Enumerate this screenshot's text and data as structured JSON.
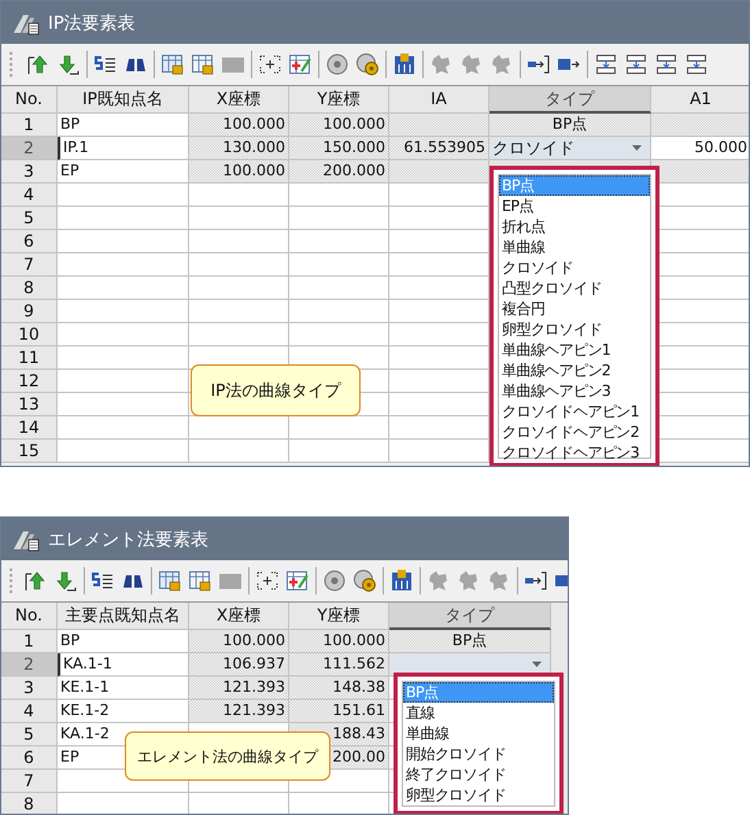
{
  "windows": [
    {
      "title": "IP法要素表",
      "columns": [
        {
          "label": "No.",
          "kind": "index",
          "selected": false
        },
        {
          "label": "IP既知点名",
          "kind": "name",
          "selected": false
        },
        {
          "label": "X座標",
          "kind": "number",
          "selected": false
        },
        {
          "label": "Y座標",
          "kind": "number",
          "selected": false
        },
        {
          "label": "IA",
          "kind": "number",
          "selected": false
        },
        {
          "label": "タイプ",
          "kind": "choice",
          "selected": true
        },
        {
          "label": "A1",
          "kind": "number",
          "selected": false
        }
      ],
      "rows": [
        {
          "no": "1",
          "selected": false,
          "cells": [
            {
              "kind": "text",
              "text": "BP",
              "shaded": false
            },
            {
              "kind": "text",
              "text": "100.000",
              "shaded": true
            },
            {
              "kind": "text",
              "text": "100.000",
              "shaded": true
            },
            {
              "kind": "text",
              "shaded": true
            },
            {
              "kind": "text",
              "text": "BP点",
              "shaded": true
            },
            {
              "kind": "text",
              "shaded": true
            }
          ]
        },
        {
          "no": "2",
          "selected": true,
          "cells": [
            {
              "kind": "text",
              "text": "IP.1",
              "shaded": false
            },
            {
              "kind": "text",
              "text": "130.000",
              "shaded": true
            },
            {
              "kind": "text",
              "text": "150.000",
              "shaded": true
            },
            {
              "kind": "text",
              "text": "61.553905",
              "shaded": true
            },
            {
              "kind": "combo",
              "text": "クロソイド"
            },
            {
              "kind": "text",
              "text": "50.000",
              "shaded": false
            }
          ]
        },
        {
          "no": "3",
          "selected": false,
          "cells": [
            {
              "kind": "text",
              "text": "EP",
              "shaded": false
            },
            {
              "kind": "text",
              "text": "100.000",
              "shaded": true
            },
            {
              "kind": "text",
              "text": "200.000",
              "shaded": true
            },
            {
              "kind": "text",
              "shaded": true
            },
            {
              "kind": "text",
              "shaded": true
            },
            {
              "kind": "text",
              "shaded": true
            }
          ]
        },
        {
          "no": "4",
          "selected": false
        },
        {
          "no": "5",
          "selected": false
        },
        {
          "no": "6",
          "selected": false
        },
        {
          "no": "7",
          "selected": false
        },
        {
          "no": "8",
          "selected": false
        },
        {
          "no": "9",
          "selected": false
        },
        {
          "no": "10",
          "selected": false
        },
        {
          "no": "11",
          "selected": false
        },
        {
          "no": "12",
          "selected": false
        },
        {
          "no": "13",
          "selected": false
        },
        {
          "no": "14",
          "selected": false
        },
        {
          "no": "15",
          "selected": false
        }
      ],
      "dropdown": [
        {
          "label": "BP点",
          "selected": true
        },
        {
          "label": "EP点",
          "selected": false
        },
        {
          "label": "折れ点",
          "selected": false
        },
        {
          "label": "単曲線",
          "selected": false
        },
        {
          "label": "クロソイド",
          "selected": false
        },
        {
          "label": "凸型クロソイド",
          "selected": false
        },
        {
          "label": "複合円",
          "selected": false
        },
        {
          "label": "卵型クロソイド",
          "selected": false
        },
        {
          "label": "単曲線ヘアピン1",
          "selected": false
        },
        {
          "label": "単曲線ヘアピン2",
          "selected": false
        },
        {
          "label": "単曲線ヘアピン3",
          "selected": false
        },
        {
          "label": "クロソイドヘアピン1",
          "selected": false
        },
        {
          "label": "クロソイドヘアピン2",
          "selected": false
        },
        {
          "label": "クロソイドヘアピン3",
          "selected": false
        }
      ],
      "callout": "IP法の曲線タイプ"
    },
    {
      "title": "エレメント法要素表",
      "columns": [
        {
          "label": "No.",
          "kind": "index",
          "selected": false
        },
        {
          "label": "主要点既知点名",
          "kind": "name",
          "selected": false
        },
        {
          "label": "X座標",
          "kind": "number",
          "selected": false
        },
        {
          "label": "Y座標",
          "kind": "number",
          "selected": false
        },
        {
          "label": "タイプ",
          "kind": "choice",
          "selected": true
        }
      ],
      "rows": [
        {
          "no": "1",
          "selected": false,
          "cells": [
            {
              "kind": "text",
              "text": "BP",
              "shaded": false
            },
            {
              "kind": "text",
              "text": "100.000",
              "shaded": true
            },
            {
              "kind": "text",
              "text": "100.000",
              "shaded": true
            },
            {
              "kind": "text",
              "text": "BP点",
              "shaded": true
            }
          ]
        },
        {
          "no": "2",
          "selected": true,
          "cells": [
            {
              "kind": "text",
              "text": "KA.1-1",
              "shaded": false
            },
            {
              "kind": "text",
              "text": "106.937",
              "shaded": true
            },
            {
              "kind": "text",
              "text": "111.562",
              "shaded": true
            },
            {
              "kind": "combo"
            }
          ]
        },
        {
          "no": "3",
          "selected": false,
          "cells": [
            {
              "kind": "text",
              "text": "KE.1-1",
              "shaded": false
            },
            {
              "kind": "text",
              "text": "121.393",
              "shaded": true
            },
            {
              "kind": "text",
              "text": "148.38",
              "shaded": true
            }
          ]
        },
        {
          "no": "4",
          "selected": false,
          "cells": [
            {
              "kind": "text",
              "text": "KE.1-2",
              "shaded": false
            },
            {
              "kind": "text",
              "text": "121.393",
              "shaded": true
            },
            {
              "kind": "text",
              "text": "151.61",
              "shaded": true
            }
          ]
        },
        {
          "no": "5",
          "selected": false,
          "cells": [
            {
              "kind": "text",
              "text": "KA.1-2",
              "shaded": false
            },
            {
              "kind": "text"
            },
            {
              "kind": "text",
              "text": "188.43",
              "shaded": true
            }
          ]
        },
        {
          "no": "6",
          "selected": false,
          "cells": [
            {
              "kind": "text",
              "text": "EP",
              "shaded": false
            },
            {
              "kind": "text"
            },
            {
              "kind": "text",
              "text": "200.00",
              "shaded": true
            }
          ]
        },
        {
          "no": "7",
          "selected": false
        },
        {
          "no": "8",
          "selected": false
        }
      ],
      "dropdown": [
        {
          "label": "BP点",
          "selected": true
        },
        {
          "label": "直線",
          "selected": false
        },
        {
          "label": "単曲線",
          "selected": false
        },
        {
          "label": "開始クロソイド",
          "selected": false
        },
        {
          "label": "終了クロソイド",
          "selected": false
        },
        {
          "label": "卵型クロソイド",
          "selected": false
        }
      ],
      "callout": "エレメント法の曲線タイプ"
    }
  ]
}
